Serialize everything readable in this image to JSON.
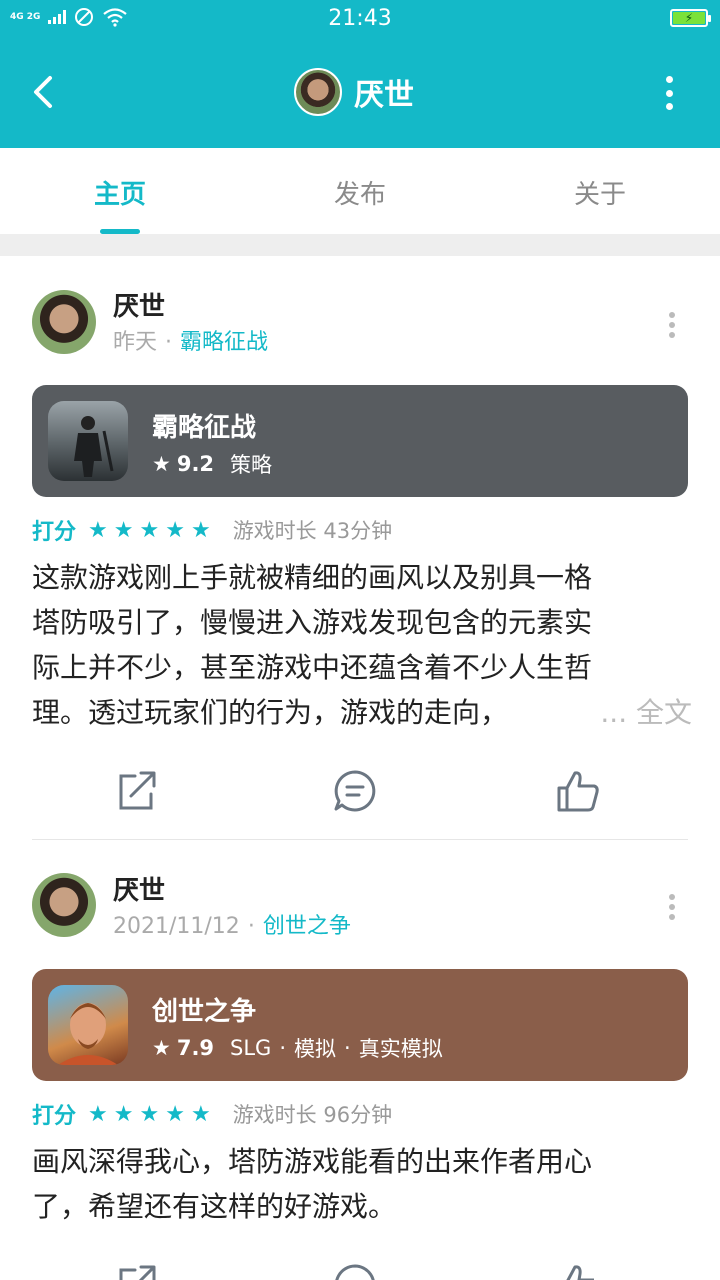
{
  "status_bar": {
    "network": "4G 2G",
    "time": "21:43"
  },
  "header": {
    "title": "厌世"
  },
  "tabs": [
    {
      "label": "主页",
      "active": true
    },
    {
      "label": "发布",
      "active": false
    },
    {
      "label": "关于",
      "active": false
    }
  ],
  "posts": [
    {
      "author": "厌世",
      "date": "昨天",
      "game_link": "霸略征战",
      "game": {
        "title": "霸略征战",
        "rating": "9.2",
        "tags": [
          "策略"
        ],
        "bg": "#585c60"
      },
      "score_label": "打分",
      "stars": 5,
      "playtime": "游戏时长 43分钟",
      "review_lines": [
        "这款游戏刚上手就被精细的画风以及别具一格",
        "塔防吸引了，慢慢进入游戏发现包含的元素实",
        "际上并不少，甚至游戏中还蕴含着不少人生哲",
        "理。透过玩家们的行为，游戏的走向，"
      ],
      "more_label": "... 全文"
    },
    {
      "author": "厌世",
      "date": "2021/11/12",
      "game_link": "创世之争",
      "game": {
        "title": "创世之争",
        "rating": "7.9",
        "tags": [
          "SLG",
          "模拟",
          "真实模拟"
        ],
        "bg": "#8a5e4a"
      },
      "score_label": "打分",
      "stars": 5,
      "playtime": "游戏时长 96分钟",
      "review_lines": [
        "画风深得我心，塔防游戏能看的出来作者用心",
        "了，希望还有这样的好游戏。"
      ]
    }
  ],
  "colors": {
    "accent": "#14b9c8"
  },
  "icons": [
    "back-arrow-icon",
    "more-vertical-icon",
    "star-icon",
    "share-icon",
    "comment-icon",
    "like-icon"
  ]
}
